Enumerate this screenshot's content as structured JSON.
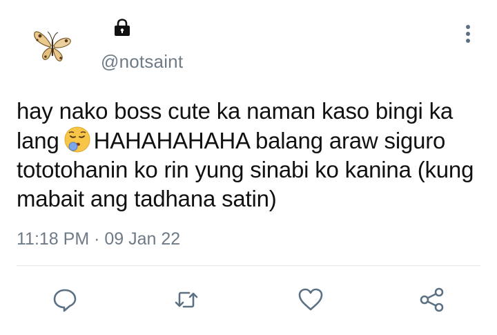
{
  "user": {
    "handle": "@notsaint",
    "avatar_icon": "butterfly-avatar",
    "protected_icon": "lock-icon"
  },
  "tweet": {
    "text_part1": "hay nako boss cute ka naman kaso bingi ka lang",
    "emoji_icon": "sleepy-face-emoji",
    "text_part2": "HAHAHAHAHA balang araw siguro tototohanin ko rin yung sinabi ko kanina (kung mabait ang tadhana satin)",
    "timestamp": "11:18 PM · 09 Jan 22"
  },
  "actions": {
    "reply_icon": "reply-icon",
    "retweet_icon": "retweet-icon",
    "like_icon": "heart-icon",
    "share_icon": "share-icon",
    "more_icon": "more-vertical-icon"
  },
  "colors": {
    "icon": "#5b7083",
    "muted_text": "#6e7b87",
    "divider": "#e3e8ec"
  }
}
